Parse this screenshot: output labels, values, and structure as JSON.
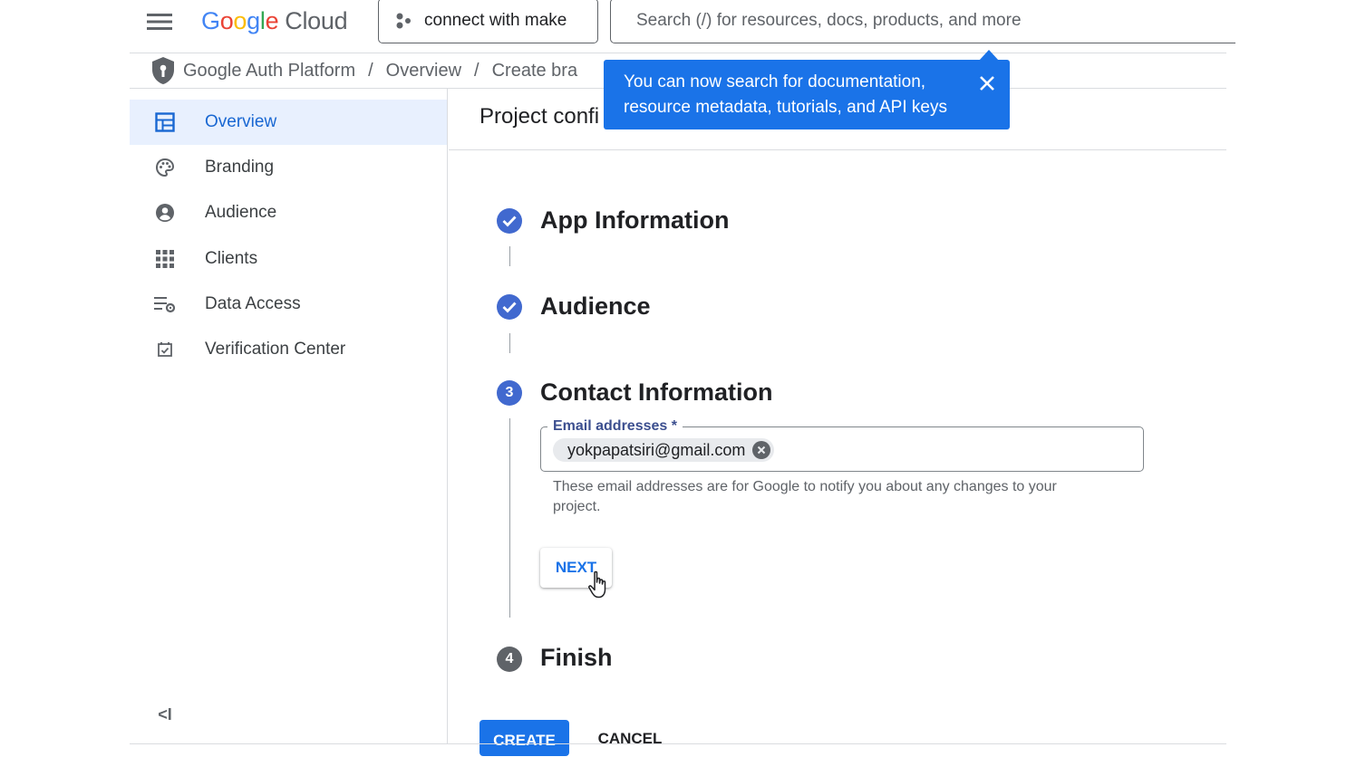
{
  "header": {
    "logo": {
      "google_letters": [
        "G",
        "o",
        "o",
        "g",
        "l",
        "e"
      ],
      "google_colors": [
        "#4285F4",
        "#EA4335",
        "#FBBC05",
        "#4285F4",
        "#34A853",
        "#EA4335"
      ],
      "cloud": "Cloud"
    },
    "project_name": "connect with make",
    "search_placeholder": "Search (/) for resources, docs, products, and more",
    "icons": {
      "menu": "hamburger-menu-icon",
      "project": "project-dots-icon"
    }
  },
  "breadcrumb": {
    "icon": "shield-icon",
    "items": [
      "Google Auth Platform",
      "Overview",
      "Create bra"
    ],
    "separator": "/"
  },
  "tooltip": {
    "line1": "You can now search for documentation,",
    "line2": "resource metadata, tutorials, and API keys",
    "close_icon": "close-icon"
  },
  "sidebar": {
    "items": [
      {
        "label": "Overview",
        "icon": "dashboard-icon",
        "active": true
      },
      {
        "label": "Branding",
        "icon": "palette-icon",
        "active": false
      },
      {
        "label": "Audience",
        "icon": "account-circle-icon",
        "active": false
      },
      {
        "label": "Clients",
        "icon": "apps-grid-icon",
        "active": false
      },
      {
        "label": "Data Access",
        "icon": "list-settings-icon",
        "active": false
      },
      {
        "label": "Verification Center",
        "icon": "checkbox-icon",
        "active": false
      }
    ],
    "collapse_label": "<I"
  },
  "main": {
    "page_title": "Project confi",
    "steps": [
      {
        "title": "App Information",
        "state": "done"
      },
      {
        "title": "Audience",
        "state": "done"
      },
      {
        "title": "Contact Information",
        "state": "current",
        "number": "3"
      },
      {
        "title": "Finish",
        "state": "pending",
        "number": "4"
      }
    ],
    "email_field": {
      "label": "Email addresses *",
      "chip": "yokpapatsiri@gmail.com",
      "helper_line1": "These email addresses are for Google to notify you about any changes to your",
      "helper_line2": "project."
    },
    "next_label": "NEXT",
    "create_label": "CREATE",
    "cancel_label": "CANCEL"
  },
  "colors": {
    "primary": "#1a73e8",
    "done_step": "#4169cf",
    "pending_step": "#5f6368",
    "active_nav_bg": "#e8f0fe"
  }
}
